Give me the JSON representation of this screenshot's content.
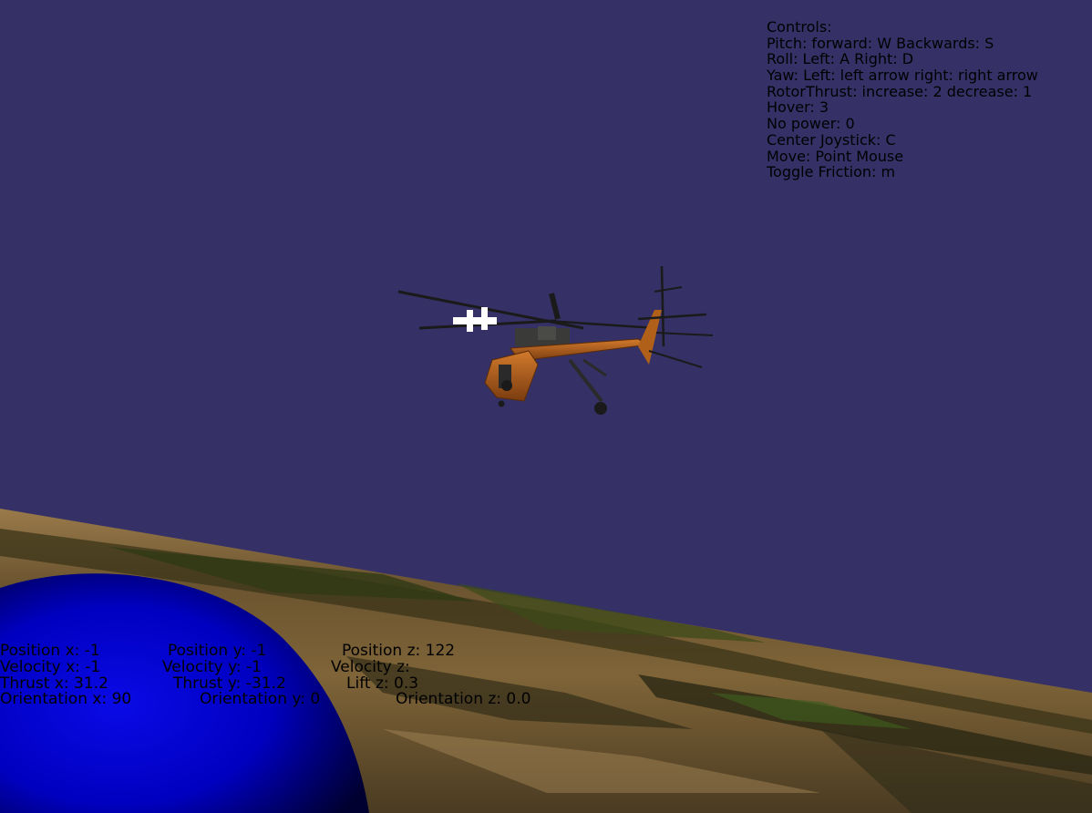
{
  "scene": {
    "colors": {
      "sky": "#353167",
      "ground_light": "#8a6a3f",
      "ground_dark": "#2f2c17",
      "vegetation": "#3d4a1a",
      "sphere": "#0000d8",
      "helicopter_body": "#b4621c",
      "helicopter_dark": "#3b3a37"
    },
    "objects": [
      "helicopter",
      "terrain",
      "blue-sphere"
    ]
  },
  "controls": {
    "title": "Controls:",
    "pitch": "Pitch: forward: W Backwards: S",
    "roll": "Roll: Left: A Right: D",
    "yaw": "Yaw: Left: left arrow right: right arrow",
    "rotor_thrust": "RotorThrust: increase: 2 decrease: 1",
    "hover": "Hover: 3",
    "no_power": "No power: 0",
    "center_joystick": "Center Joystick: C",
    "move": "Move: Point Mouse",
    "toggle_friction": "Toggle Friction: m"
  },
  "hud": {
    "position": {
      "x": "Position x: -1",
      "y": "Position y: -1",
      "z": "Position z: 122"
    },
    "velocity": {
      "x": "Velocity x: -1",
      "y": "Velocity y: -1",
      "z": "Velocity z:"
    },
    "thrust": {
      "x": "Thrust x: 31.2",
      "y": "Thrust y: -31.2",
      "lift": "Lift z: 0.3"
    },
    "orientation": {
      "x": "Orientation x: 90",
      "y": "Orientation y: 0",
      "z": "Orientation z: 0.0"
    }
  }
}
